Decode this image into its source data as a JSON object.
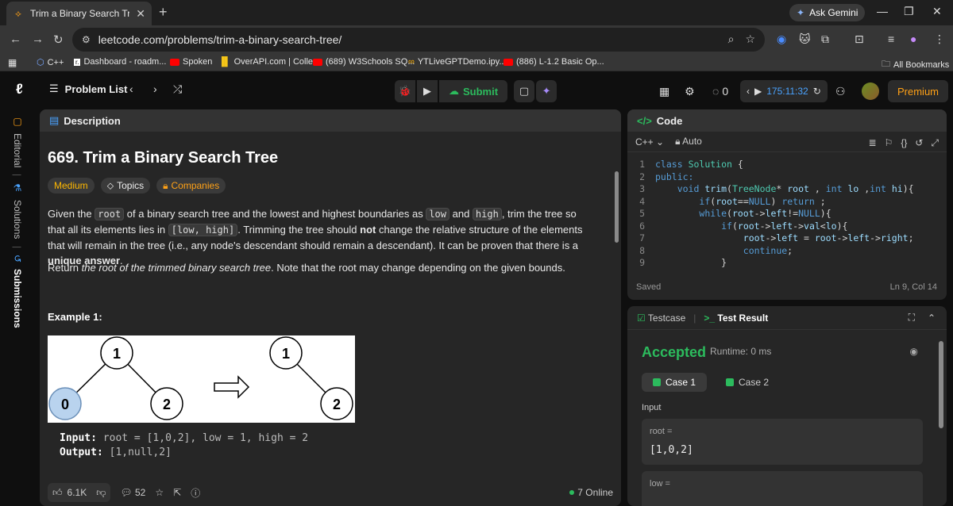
{
  "browser": {
    "tab_title": "Trim a Binary Search Tree - Leet",
    "gemini_label": "Ask Gemini",
    "url": "leetcode.com/problems/trim-a-binary-search-tree/",
    "bookmarks": [
      "C++",
      "Dashboard - roadm...",
      "Spoken",
      "OverAPI.com | Colle...",
      "(689) W3Schools SQ...",
      "YTLiveGPTDemo.ipy...",
      "(886) L-1.2 Basic Op..."
    ],
    "all_bookmarks": "All Bookmarks"
  },
  "leetcode": {
    "problem_list": "Problem List",
    "submit": "Submit",
    "streak": "0",
    "timer": "175:11:32",
    "premium": "Premium"
  },
  "sidebar": {
    "editorial": "Editorial",
    "solutions": "Solutions",
    "submissions": "Submissions"
  },
  "description": {
    "header": "Description",
    "title": "669. Trim a Binary Search Tree",
    "difficulty": "Medium",
    "topics": "Topics",
    "companies": "Companies",
    "p1_a": "Given the ",
    "p1_root": "root",
    "p1_b": " of a binary search tree and the lowest and highest boundaries as ",
    "p1_low": "low",
    "p1_c": " and ",
    "p1_high": "high",
    "p1_d": ", trim the tree so that all its elements lies in ",
    "p1_range": "[low, high]",
    "p1_e": ". Trimming the tree should ",
    "p1_not": "not",
    "p1_f": " change the relative structure of the elements that will remain in the tree (i.e., any node's descendant should remain a descendant). It can be proven that there is a ",
    "p1_unique": "unique answer",
    "p1_g": ".",
    "p2_a": "Return ",
    "p2_em": "the root of the trimmed binary search tree",
    "p2_b": ". Note that the root may change depending on the given bounds.",
    "example_title": "Example 1:",
    "tree_left": [
      "1",
      "0",
      "2"
    ],
    "tree_right": [
      "1",
      "2"
    ],
    "input_label": "Input:",
    "input_value": "root = [1,0,2], low = 1, high = 2",
    "output_label": "Output:",
    "output_value": "[1,null,2]",
    "likes": "6.1K",
    "comments": "52",
    "online": "7 Online"
  },
  "code": {
    "header": "Code",
    "language": "C++",
    "auto": "Auto",
    "saved": "Saved",
    "cursor": "Ln 9, Col 14",
    "lines": [
      "class Solution {",
      "public:",
      "    void trim(TreeNode* root , int lo ,int hi){",
      "        if(root==NULL) return ;",
      "        while(root->left!=NULL){",
      "            if(root->left->val<lo){",
      "                root->left = root->left->right;",
      "                continue;",
      "            }"
    ]
  },
  "test": {
    "testcase_tab": "Testcase",
    "result_tab": "Test Result",
    "status": "Accepted",
    "runtime": "Runtime: 0 ms",
    "case1": "Case 1",
    "case2": "Case 2",
    "input_label": "Input",
    "root_key": "root =",
    "root_value": "[1,0,2]",
    "low_key": "low ="
  }
}
